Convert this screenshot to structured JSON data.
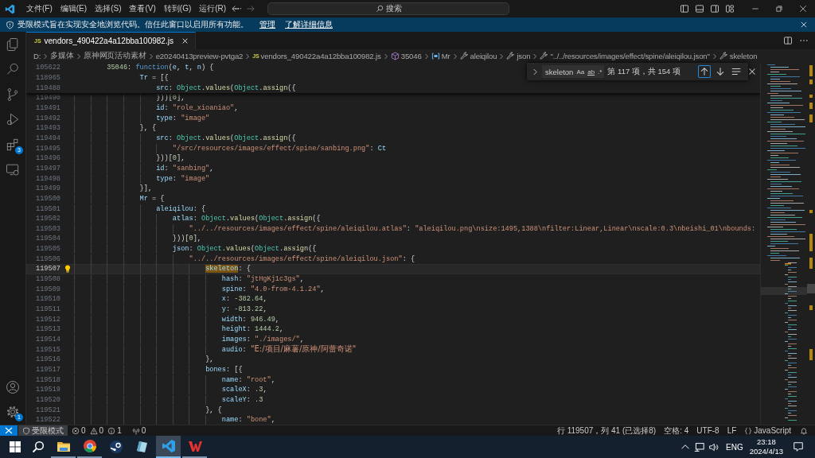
{
  "title_bar": {
    "menu": [
      "文件(F)",
      "编辑(E)",
      "选择(S)",
      "查看(V)",
      "转到(G)",
      "运行(R)",
      "···"
    ],
    "search_placeholder": "搜索"
  },
  "banner": {
    "message": "受限模式旨在实现安全地浏览代码。信任此窗口以启用所有功能。",
    "links": [
      "管理",
      "了解详细信息"
    ]
  },
  "activity_bar": [
    {
      "kind": "files"
    },
    {
      "kind": "search"
    },
    {
      "kind": "source-control"
    },
    {
      "kind": "run-debug"
    },
    {
      "kind": "extensions",
      "badge": "3"
    },
    {
      "kind": "remote"
    },
    {
      "kind": "account"
    },
    {
      "kind": "settings",
      "badge": "1"
    }
  ],
  "tabs": [
    {
      "icon_text": "JS",
      "label": "vendors_490422a4a12bba100982.js",
      "selected": true
    }
  ],
  "breadcrumbs": [
    {
      "kind": "folder",
      "label": "D:"
    },
    {
      "kind": "folder",
      "label": "多媒体"
    },
    {
      "kind": "folder",
      "label": "原神网页活动素材"
    },
    {
      "kind": "folder",
      "label": "e20240413preview-pvtga2"
    },
    {
      "kind": "file",
      "icon_text": "JS",
      "label": "vendors_490422a4a12bba100982.js"
    },
    {
      "kind": "module",
      "label": "35046"
    },
    {
      "kind": "variable",
      "label": "Mr"
    },
    {
      "kind": "property",
      "label": "aleiqilou"
    },
    {
      "kind": "property",
      "label": "json"
    },
    {
      "kind": "property",
      "label": "\"../../resources/images/effect/spine/aleiqilou.json\""
    },
    {
      "kind": "property",
      "label": "skeleton"
    }
  ],
  "find_widget": {
    "value": "skeleton",
    "options": [
      "Aa",
      "ab",
      ".*"
    ],
    "result": "第 117 项，共 154 项"
  },
  "editor": {
    "sticky_lines": [
      {
        "number": "105622",
        "tokens": [
          {
            "kind": "num",
            "text": "        35046"
          },
          {
            "kind": "p",
            "text": ": "
          },
          {
            "kind": "kw",
            "text": "function"
          },
          {
            "kind": "p",
            "text": "("
          },
          {
            "kind": "var",
            "text": "e"
          },
          {
            "kind": "p",
            "text": ", "
          },
          {
            "kind": "var",
            "text": "t"
          },
          {
            "kind": "p",
            "text": ", "
          },
          {
            "kind": "var",
            "text": "n"
          },
          {
            "kind": "p",
            "text": ") {"
          }
        ]
      },
      {
        "number": "118965",
        "tokens": [
          {
            "kind": "var",
            "text": "                Tr"
          },
          {
            "kind": "p",
            "text": " = [{"
          }
        ]
      },
      {
        "number": "119488",
        "tokens": [
          {
            "kind": "key",
            "text": "                    src"
          },
          {
            "kind": "p",
            "text": ": "
          },
          {
            "kind": "cls",
            "text": "Object"
          },
          {
            "kind": "p",
            "text": "."
          },
          {
            "kind": "fn",
            "text": "values"
          },
          {
            "kind": "p",
            "text": "("
          },
          {
            "kind": "cls",
            "text": "Object"
          },
          {
            "kind": "p",
            "text": "."
          },
          {
            "kind": "fn",
            "text": "assign"
          },
          {
            "kind": "p",
            "text": "({"
          }
        ]
      }
    ],
    "lines": [
      {
        "number": "119490",
        "current": false,
        "lightbulb": false,
        "tokens": [
          {
            "kind": "p",
            "text": "                    }))["
          },
          {
            "kind": "num",
            "text": "0"
          },
          {
            "kind": "p",
            "text": "],"
          }
        ]
      },
      {
        "number": "119491",
        "current": false,
        "lightbulb": false,
        "tokens": [
          {
            "kind": "key",
            "text": "                    id"
          },
          {
            "kind": "p",
            "text": ": "
          },
          {
            "kind": "str",
            "text": "\"role_xioaniao\""
          },
          {
            "kind": "p",
            "text": ","
          }
        ]
      },
      {
        "number": "119492",
        "current": false,
        "lightbulb": false,
        "tokens": [
          {
            "kind": "key",
            "text": "                    type"
          },
          {
            "kind": "p",
            "text": ": "
          },
          {
            "kind": "str",
            "text": "\"image\""
          }
        ]
      },
      {
        "number": "119493",
        "current": false,
        "lightbulb": false,
        "tokens": [
          {
            "kind": "p",
            "text": "                }, {"
          }
        ]
      },
      {
        "number": "119494",
        "current": false,
        "lightbulb": false,
        "tokens": [
          {
            "kind": "key",
            "text": "                    src"
          },
          {
            "kind": "p",
            "text": ": "
          },
          {
            "kind": "cls",
            "text": "Object"
          },
          {
            "kind": "p",
            "text": "."
          },
          {
            "kind": "fn",
            "text": "values"
          },
          {
            "kind": "p",
            "text": "("
          },
          {
            "kind": "cls",
            "text": "Object"
          },
          {
            "kind": "p",
            "text": "."
          },
          {
            "kind": "fn",
            "text": "assign"
          },
          {
            "kind": "p",
            "text": "({"
          }
        ]
      },
      {
        "number": "119495",
        "current": false,
        "lightbulb": false,
        "tokens": [
          {
            "kind": "str",
            "text": "                        \"/src/resources/images/effect/spine/sanbing.png\""
          },
          {
            "kind": "p",
            "text": ": "
          },
          {
            "kind": "var",
            "text": "Ct"
          }
        ]
      },
      {
        "number": "119496",
        "current": false,
        "lightbulb": false,
        "tokens": [
          {
            "kind": "p",
            "text": "                    }))["
          },
          {
            "kind": "num",
            "text": "0"
          },
          {
            "kind": "p",
            "text": "],"
          }
        ]
      },
      {
        "number": "119497",
        "current": false,
        "lightbulb": false,
        "tokens": [
          {
            "kind": "key",
            "text": "                    id"
          },
          {
            "kind": "p",
            "text": ": "
          },
          {
            "kind": "str",
            "text": "\"sanbing\""
          },
          {
            "kind": "p",
            "text": ","
          }
        ]
      },
      {
        "number": "119498",
        "current": false,
        "lightbulb": false,
        "tokens": [
          {
            "kind": "key",
            "text": "                    type"
          },
          {
            "kind": "p",
            "text": ": "
          },
          {
            "kind": "str",
            "text": "\"image\""
          }
        ]
      },
      {
        "number": "119499",
        "current": false,
        "lightbulb": false,
        "tokens": [
          {
            "kind": "p",
            "text": "                }],"
          }
        ]
      },
      {
        "number": "119500",
        "current": false,
        "lightbulb": false,
        "tokens": [
          {
            "kind": "var",
            "text": "                Mr"
          },
          {
            "kind": "p",
            "text": " = {"
          }
        ]
      },
      {
        "number": "119501",
        "current": false,
        "lightbulb": false,
        "tokens": [
          {
            "kind": "key",
            "text": "                    aleiqilou"
          },
          {
            "kind": "p",
            "text": ": {"
          }
        ]
      },
      {
        "number": "119502",
        "current": false,
        "lightbulb": false,
        "tokens": [
          {
            "kind": "key",
            "text": "                        atlas"
          },
          {
            "kind": "p",
            "text": ": "
          },
          {
            "kind": "cls",
            "text": "Object"
          },
          {
            "kind": "p",
            "text": "."
          },
          {
            "kind": "fn",
            "text": "values"
          },
          {
            "kind": "p",
            "text": "("
          },
          {
            "kind": "cls",
            "text": "Object"
          },
          {
            "kind": "p",
            "text": "."
          },
          {
            "kind": "fn",
            "text": "assign"
          },
          {
            "kind": "p",
            "text": "({"
          }
        ]
      },
      {
        "number": "119503",
        "current": false,
        "lightbulb": false,
        "tokens": [
          {
            "kind": "str",
            "text": "                            \"../../resources/images/effect/spine/aleiqilou.atlas\""
          },
          {
            "kind": "p",
            "text": ": "
          },
          {
            "kind": "str",
            "text": "\"aleiqilou.png\\nsize:1495,1388\\nfilter:Linear,Linear\\nscale:0.3\\nbeishi_01\\nbounds:"
          }
        ]
      },
      {
        "number": "119504",
        "current": false,
        "lightbulb": false,
        "tokens": [
          {
            "kind": "p",
            "text": "                        }))["
          },
          {
            "kind": "num",
            "text": "0"
          },
          {
            "kind": "p",
            "text": "],"
          }
        ]
      },
      {
        "number": "119505",
        "current": false,
        "lightbulb": false,
        "tokens": [
          {
            "kind": "key",
            "text": "                        json"
          },
          {
            "kind": "p",
            "text": ": "
          },
          {
            "kind": "cls",
            "text": "Object"
          },
          {
            "kind": "p",
            "text": "."
          },
          {
            "kind": "fn",
            "text": "values"
          },
          {
            "kind": "p",
            "text": "("
          },
          {
            "kind": "cls",
            "text": "Object"
          },
          {
            "kind": "p",
            "text": "."
          },
          {
            "kind": "fn",
            "text": "assign"
          },
          {
            "kind": "p",
            "text": "({"
          }
        ]
      },
      {
        "number": "119506",
        "current": false,
        "lightbulb": false,
        "tokens": [
          {
            "kind": "str",
            "text": "                            \"../../resources/images/effect/spine/aleiqilou.json\""
          },
          {
            "kind": "p",
            "text": ": {"
          }
        ]
      },
      {
        "number": "119507",
        "current": true,
        "lightbulb": true,
        "tokens": [
          {
            "kind": "match",
            "text": "                                skeleton"
          },
          {
            "kind": "p",
            "text": ": {"
          }
        ]
      },
      {
        "number": "119508",
        "current": false,
        "lightbulb": false,
        "tokens": [
          {
            "kind": "key",
            "text": "                                    hash"
          },
          {
            "kind": "p",
            "text": ": "
          },
          {
            "kind": "str",
            "text": "\"jtHgKj1c3gs\""
          },
          {
            "kind": "p",
            "text": ","
          }
        ]
      },
      {
        "number": "119509",
        "current": false,
        "lightbulb": false,
        "tokens": [
          {
            "kind": "key",
            "text": "                                    spine"
          },
          {
            "kind": "p",
            "text": ": "
          },
          {
            "kind": "str",
            "text": "\"4.0-from-4.1.24\""
          },
          {
            "kind": "p",
            "text": ","
          }
        ]
      },
      {
        "number": "119510",
        "current": false,
        "lightbulb": false,
        "tokens": [
          {
            "kind": "key",
            "text": "                                    x"
          },
          {
            "kind": "p",
            "text": ": "
          },
          {
            "kind": "num",
            "text": "-382.64"
          },
          {
            "kind": "p",
            "text": ","
          }
        ]
      },
      {
        "number": "119511",
        "current": false,
        "lightbulb": false,
        "tokens": [
          {
            "kind": "key",
            "text": "                                    y"
          },
          {
            "kind": "p",
            "text": ": "
          },
          {
            "kind": "num",
            "text": "-813.22"
          },
          {
            "kind": "p",
            "text": ","
          }
        ]
      },
      {
        "number": "119512",
        "current": false,
        "lightbulb": false,
        "tokens": [
          {
            "kind": "key",
            "text": "                                    width"
          },
          {
            "kind": "p",
            "text": ": "
          },
          {
            "kind": "num",
            "text": "946.49"
          },
          {
            "kind": "p",
            "text": ","
          }
        ]
      },
      {
        "number": "119513",
        "current": false,
        "lightbulb": false,
        "tokens": [
          {
            "kind": "key",
            "text": "                                    height"
          },
          {
            "kind": "p",
            "text": ": "
          },
          {
            "kind": "num",
            "text": "1444.2"
          },
          {
            "kind": "p",
            "text": ","
          }
        ]
      },
      {
        "number": "119514",
        "current": false,
        "lightbulb": false,
        "tokens": [
          {
            "kind": "key",
            "text": "                                    images"
          },
          {
            "kind": "p",
            "text": ": "
          },
          {
            "kind": "str",
            "text": "\"./images/\""
          },
          {
            "kind": "p",
            "text": ","
          }
        ]
      },
      {
        "number": "119515",
        "current": false,
        "lightbulb": false,
        "tokens": [
          {
            "kind": "key",
            "text": "                                    audio"
          },
          {
            "kind": "p",
            "text": ": "
          },
          {
            "kind": "str_cjk",
            "text": "\"E:/项目/麻薯/原神/阿蕾奇诺\""
          }
        ]
      },
      {
        "number": "119516",
        "current": false,
        "lightbulb": false,
        "tokens": [
          {
            "kind": "p",
            "text": "                                },"
          }
        ]
      },
      {
        "number": "119517",
        "current": false,
        "lightbulb": false,
        "tokens": [
          {
            "kind": "key",
            "text": "                                bones"
          },
          {
            "kind": "p",
            "text": ": [{"
          }
        ]
      },
      {
        "number": "119518",
        "current": false,
        "lightbulb": false,
        "tokens": [
          {
            "kind": "key",
            "text": "                                    name"
          },
          {
            "kind": "p",
            "text": ": "
          },
          {
            "kind": "str",
            "text": "\"root\""
          },
          {
            "kind": "p",
            "text": ","
          }
        ]
      },
      {
        "number": "119519",
        "current": false,
        "lightbulb": false,
        "tokens": [
          {
            "kind": "key",
            "text": "                                    scaleX"
          },
          {
            "kind": "p",
            "text": ": "
          },
          {
            "kind": "num",
            "text": ".3"
          },
          {
            "kind": "p",
            "text": ","
          }
        ]
      },
      {
        "number": "119520",
        "current": false,
        "lightbulb": false,
        "tokens": [
          {
            "kind": "key",
            "text": "                                    scaleY"
          },
          {
            "kind": "p",
            "text": ": "
          },
          {
            "kind": "num",
            "text": ".3"
          }
        ]
      },
      {
        "number": "119521",
        "current": false,
        "lightbulb": false,
        "tokens": [
          {
            "kind": "p",
            "text": "                                }, {"
          }
        ]
      },
      {
        "number": "119522",
        "current": false,
        "lightbulb": false,
        "tokens": [
          {
            "kind": "key",
            "text": "                                    name"
          },
          {
            "kind": "p",
            "text": ": "
          },
          {
            "kind": "str",
            "text": "\"bone\""
          },
          {
            "kind": "p",
            "text": ","
          }
        ]
      }
    ]
  },
  "status_bar": {
    "restricted": "受限模式",
    "problems": [
      {
        "kind": "error",
        "count": "0"
      },
      {
        "kind": "warning",
        "count": "0"
      },
      {
        "kind": "info",
        "count": "1"
      }
    ],
    "ports": "0",
    "right": [
      {
        "kind": "text",
        "label": "行 119507，列 41 (已选择8)"
      },
      {
        "kind": "text",
        "label": "空格: 4"
      },
      {
        "kind": "text",
        "label": "UTF-8"
      },
      {
        "kind": "text",
        "label": "LF"
      },
      {
        "kind": "language",
        "label": "JavaScript"
      }
    ]
  },
  "taskbar": {
    "apps": [
      {
        "kind": "explorer",
        "running": true,
        "active": false
      },
      {
        "kind": "chrome",
        "running": true,
        "active": false
      },
      {
        "kind": "steam",
        "running": false,
        "active": false
      },
      {
        "kind": "notepad",
        "running": false,
        "active": false
      },
      {
        "kind": "vscode",
        "running": true,
        "active": true
      },
      {
        "kind": "wps",
        "running": true,
        "active": false
      }
    ],
    "language": "ENG",
    "time": "23:18",
    "date": "2024/4/13"
  }
}
